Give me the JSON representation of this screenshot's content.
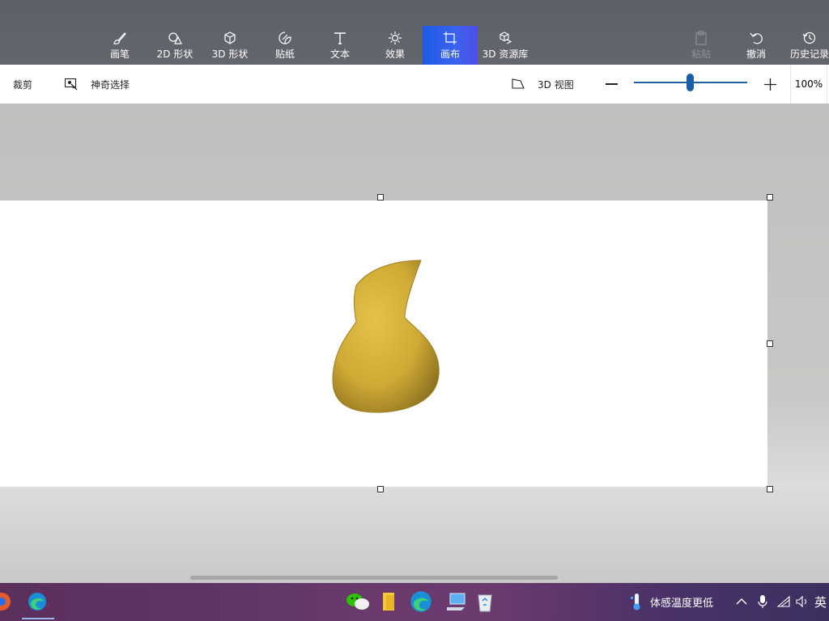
{
  "ribbon": {
    "tools": [
      {
        "id": "brush",
        "label": "画笔",
        "icon": "brush-icon"
      },
      {
        "id": "shapes2d",
        "label": "2D 形状",
        "icon": "shapes-2d-icon"
      },
      {
        "id": "shapes3d",
        "label": "3D 形状",
        "icon": "cube-icon"
      },
      {
        "id": "stickers",
        "label": "贴纸",
        "icon": "sticker-icon"
      },
      {
        "id": "text",
        "label": "文本",
        "icon": "text-icon"
      },
      {
        "id": "effects",
        "label": "效果",
        "icon": "sun-icon"
      },
      {
        "id": "canvas",
        "label": "画布",
        "icon": "crop-canvas-icon",
        "active": true
      },
      {
        "id": "library3d",
        "label": "3D 资源库",
        "icon": "3d-library-icon"
      }
    ],
    "right_tools": [
      {
        "id": "paste",
        "label": "粘贴",
        "icon": "paste-icon",
        "disabled": true
      },
      {
        "id": "undo",
        "label": "撤消",
        "icon": "undo-icon"
      },
      {
        "id": "history",
        "label": "历史记录",
        "icon": "history-icon"
      }
    ],
    "active_color": "#2f5fea"
  },
  "subbar": {
    "crop_label": "裁剪",
    "magic_select_label": "神奇选择",
    "view3d_label": "3D 视图",
    "zoom_value": "100%",
    "zoom_level": 0.5
  },
  "canvas": {
    "object_color": "#d4af37",
    "object": "3d-blob-shape"
  },
  "taskbar": {
    "apps": [
      "browser-icon",
      "edge-icon",
      "wechat-icon",
      "file-explorer-icon",
      "edge-icon",
      "this-pc-icon",
      "recycle-bin-icon"
    ],
    "weather_text": "体感温度更低",
    "ime_text": "英"
  }
}
